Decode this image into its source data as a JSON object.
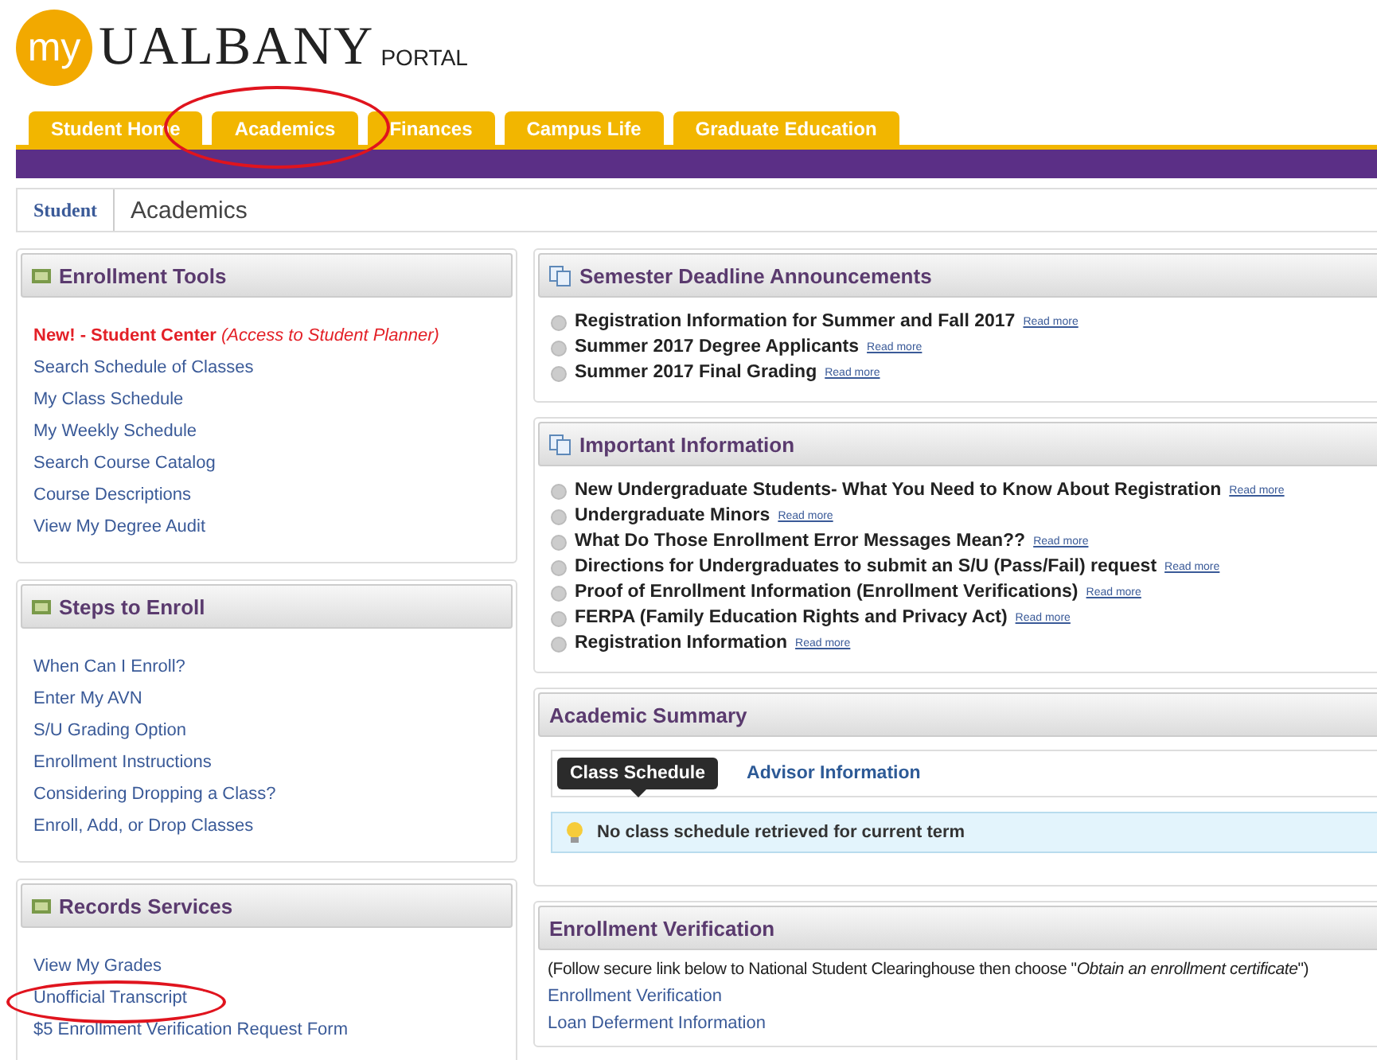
{
  "logo": {
    "badge": "my",
    "name": "UALBANY",
    "suffix": "PORTAL"
  },
  "tabs": [
    {
      "label": "Student Home"
    },
    {
      "label": "Academics"
    },
    {
      "label": "Finances"
    },
    {
      "label": "Campus Life"
    },
    {
      "label": "Graduate Education"
    }
  ],
  "breadcrumb": {
    "parent": "Student",
    "current": "Academics"
  },
  "left_panels": [
    {
      "title": "Enrollment Tools",
      "links": [
        {
          "text": "**New! - Student Center** *(Access to Student Planner)*",
          "kind": "highlight"
        },
        {
          "text": "Search Schedule of Classes",
          "kind": "link"
        },
        {
          "text": "My Class Schedule",
          "kind": "link"
        },
        {
          "text": "My Weekly Schedule",
          "kind": "link"
        },
        {
          "text": "Search Course Catalog",
          "kind": "link"
        },
        {
          "text": "Course Descriptions",
          "kind": "link"
        },
        {
          "text": "View My Degree Audit",
          "kind": "link"
        }
      ]
    },
    {
      "title": "Steps to Enroll",
      "links": [
        {
          "text": "When Can I Enroll?",
          "kind": "link"
        },
        {
          "text": "Enter My AVN",
          "kind": "link"
        },
        {
          "text": "S/U Grading Option",
          "kind": "link"
        },
        {
          "text": "Enrollment Instructions",
          "kind": "link"
        },
        {
          "text": "Considering Dropping a Class?",
          "kind": "link"
        },
        {
          "text": "Enroll, Add, or Drop Classes",
          "kind": "link"
        }
      ]
    },
    {
      "title": "Records Services",
      "links": [
        {
          "text": "View My Grades",
          "kind": "link"
        },
        {
          "text": "Unofficial Transcript",
          "kind": "link"
        },
        {
          "text": "$5 Enrollment Verification Request Form",
          "kind": "link"
        }
      ]
    }
  ],
  "announcements": [
    {
      "title": "Semester Deadline Announcements",
      "items": [
        {
          "text": "Registration Information for Summer and Fall 2017",
          "more": "Read more"
        },
        {
          "text": "Summer 2017 Degree Applicants",
          "more": "Read more"
        },
        {
          "text": "Summer 2017 Final Grading",
          "more": "Read more"
        }
      ]
    },
    {
      "title": "Important Information",
      "items": [
        {
          "text": "New Undergraduate Students- What You Need to Know About Registration",
          "more": "Read more"
        },
        {
          "text": "Undergraduate Minors",
          "more": "Read more"
        },
        {
          "text": "What Do Those Enrollment Error Messages Mean??",
          "more": "Read more"
        },
        {
          "text": "Directions for Undergraduates to submit an S/U (Pass/Fail) request",
          "more": "Read more"
        },
        {
          "text": "Proof of Enrollment Information (Enrollment Verifications)",
          "more": "Read more"
        },
        {
          "text": "FERPA (Family Education Rights and Privacy Act)",
          "more": "Read more"
        },
        {
          "text": "Registration Information",
          "more": "Read more"
        }
      ]
    }
  ],
  "academic_summary": {
    "title": "Academic Summary",
    "tabs": [
      {
        "label": "Class Schedule",
        "selected": true
      },
      {
        "label": "Advisor Information",
        "selected": false
      }
    ],
    "message": "No class schedule retrieved for current term"
  },
  "enrollment_verification": {
    "title": "Enrollment Verification",
    "note": "(Follow secure link below to National Student Clearinghouse then choose \"*Obtain an enrollment certificate*\")",
    "links": [
      "Enrollment Verification",
      "Loan Deferment Information"
    ]
  },
  "annotations": [
    {
      "kind": "ellipse"
    },
    {
      "kind": "ellipse"
    }
  ]
}
